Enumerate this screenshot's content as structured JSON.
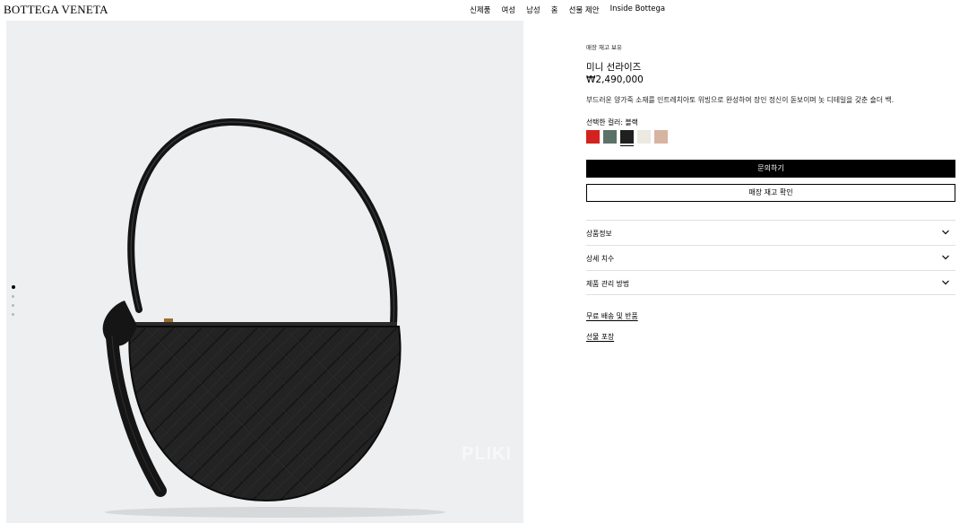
{
  "header": {
    "logo": "BOTTEGA VENETA",
    "nav": [
      "신제품",
      "여성",
      "남성",
      "홈",
      "선물 제안",
      "Inside Bottega"
    ]
  },
  "gallery": {
    "watermark": "PLIKI",
    "dot_count": 4,
    "active_index": 0
  },
  "product": {
    "stock_note": "매장 재고 보유",
    "title": "미니 선라이즈",
    "price": "₩2,490,000",
    "description": "부드러운 양가죽 소재를 인트레치아토 위빙으로 완성하여 장인 정신이 돋보이며 놋 디테일을 갖춘 숄더 백.",
    "color_label": "선택한 컬러: 블랙",
    "swatches": [
      {
        "color": "#d4221f",
        "selected": false
      },
      {
        "color": "#5b7268",
        "selected": false
      },
      {
        "color": "#1f1f1f",
        "selected": true
      },
      {
        "color": "#ece9e1",
        "selected": false
      },
      {
        "color": "#d7b3a1",
        "selected": false
      }
    ],
    "inquire_label": "문의하기",
    "store_check_label": "매장 재고 확인",
    "accordion": [
      "상품정보",
      "상세 치수",
      "제품 관리 방법"
    ],
    "links": [
      "무료 배송 및 반품",
      "선물 포장"
    ]
  }
}
